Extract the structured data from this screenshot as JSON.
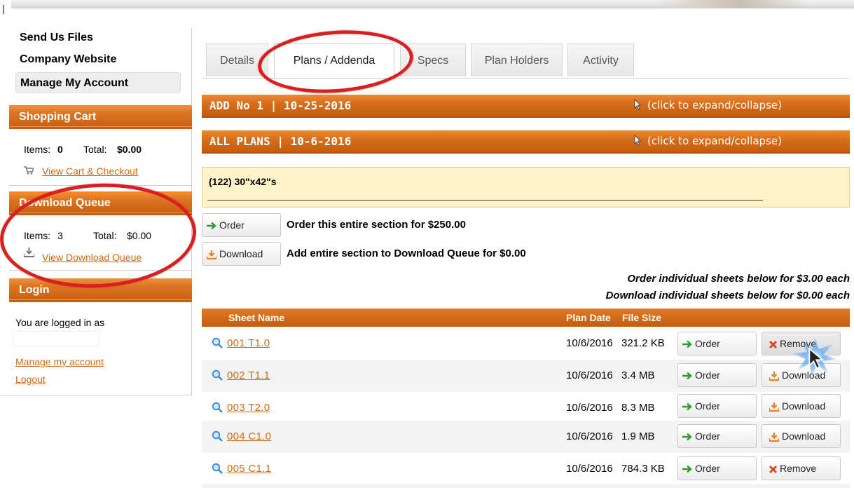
{
  "sidebar": {
    "links": [
      "Send Us Files",
      "Company Website",
      "Manage My Account"
    ],
    "shopping_cart": {
      "title": "Shopping Cart",
      "items_label": "Items:",
      "items_value": "0",
      "total_label": "Total:",
      "total_value": "$0.00",
      "link": "View Cart & Checkout"
    },
    "download_queue": {
      "title": "Download Queue",
      "items_label": "Items:",
      "items_value": "3",
      "total_label": "Total:",
      "total_value": "$0.00",
      "link": "View Download Queue"
    },
    "login": {
      "title": "Login",
      "logged_in_text": "You are logged in as",
      "manage_link": "Manage my account",
      "logout_link": "Logout"
    }
  },
  "tabs": [
    "Details",
    "Plans / Addenda",
    "Specs",
    "Plan Holders",
    "Activity"
  ],
  "active_tab": "Plans / Addenda",
  "sections": [
    {
      "title": "ADD No 1 | 10-25-2016",
      "expand_label": "(click to expand/collapse)"
    },
    {
      "title": "ALL PLANS | 10-6-2016",
      "expand_label": "(click to expand/collapse)"
    }
  ],
  "sheet_size": "(122) 30\"x42\"s",
  "section_actions": {
    "order_button": "Order",
    "order_text": "Order this entire section for $250.00",
    "download_button": "Download",
    "download_text": "Add entire section to Download Queue for $0.00"
  },
  "notes": {
    "order_individual": "Order individual sheets below for $3.00 each",
    "download_individual": "Download individual sheets below for $0.00 each"
  },
  "table": {
    "columns": {
      "sheet_name": "Sheet Name",
      "plan_date": "Plan Date",
      "file_size": "File Size"
    },
    "rows": [
      {
        "sheet": "001   T1.0",
        "date": "10/6/2016",
        "size": "321.2 KB",
        "order": "Order",
        "action": "Remove"
      },
      {
        "sheet": "002   T1.1",
        "date": "10/6/2016",
        "size": "3.4 MB",
        "order": "Order",
        "action": "Download"
      },
      {
        "sheet": "003   T2.0",
        "date": "10/6/2016",
        "size": "8.3 MB",
        "order": "Order",
        "action": "Download"
      },
      {
        "sheet": "004   C1.0",
        "date": "10/6/2016",
        "size": "1.9 MB",
        "order": "Order",
        "action": "Download"
      },
      {
        "sheet": "005   C1.1",
        "date": "10/6/2016",
        "size": "784.3 KB",
        "order": "Order",
        "action": "Remove"
      }
    ]
  },
  "colors": {
    "accent_orange": "#d86e1b",
    "link_orange": "#cf6a12",
    "highlight_yellow": "#fdf2c8",
    "annotation_red": "#d91f1f"
  }
}
